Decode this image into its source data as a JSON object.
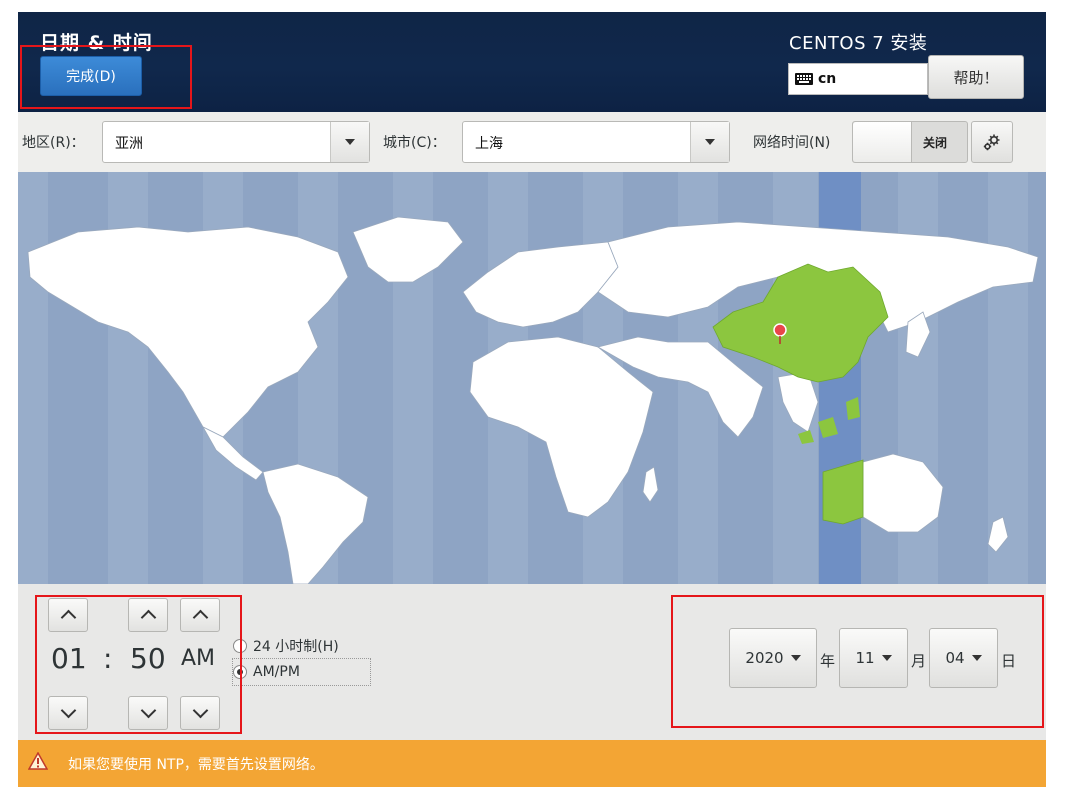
{
  "header": {
    "spoke_title": "日期 & 时间",
    "done_button": "完成(D)",
    "product_title": "CENTOS 7 安装",
    "keyboard_layout": "cn",
    "help_button": "帮助！"
  },
  "toolbar": {
    "region_label": "地区(R)：",
    "region_value": "亚洲",
    "city_label": "城市(C)：",
    "city_value": "上海",
    "ntp_label": "网络时间(N)",
    "ntp_state": "关闭"
  },
  "time": {
    "hour": "01",
    "separator": ":",
    "minute": "50",
    "period": "AM",
    "format_24h": "24 小时制(H)",
    "format_ampm": "AM/PM",
    "selected_format": "AM/PM"
  },
  "date": {
    "year": "2020",
    "year_unit": "年",
    "month": "11",
    "month_unit": "月",
    "day": "04",
    "day_unit": "日"
  },
  "warning": {
    "message": "如果您要使用 NTP，需要首先设置网络。"
  },
  "colors": {
    "header_bg": "#10284c",
    "accent_button": "#3584d6",
    "map_ocean": "#8ea4c4",
    "selected_region": "#8cc63f",
    "timezone_band": "#6f8fc4",
    "warning_bar": "#f3a534",
    "annotation": "#e5161a"
  }
}
